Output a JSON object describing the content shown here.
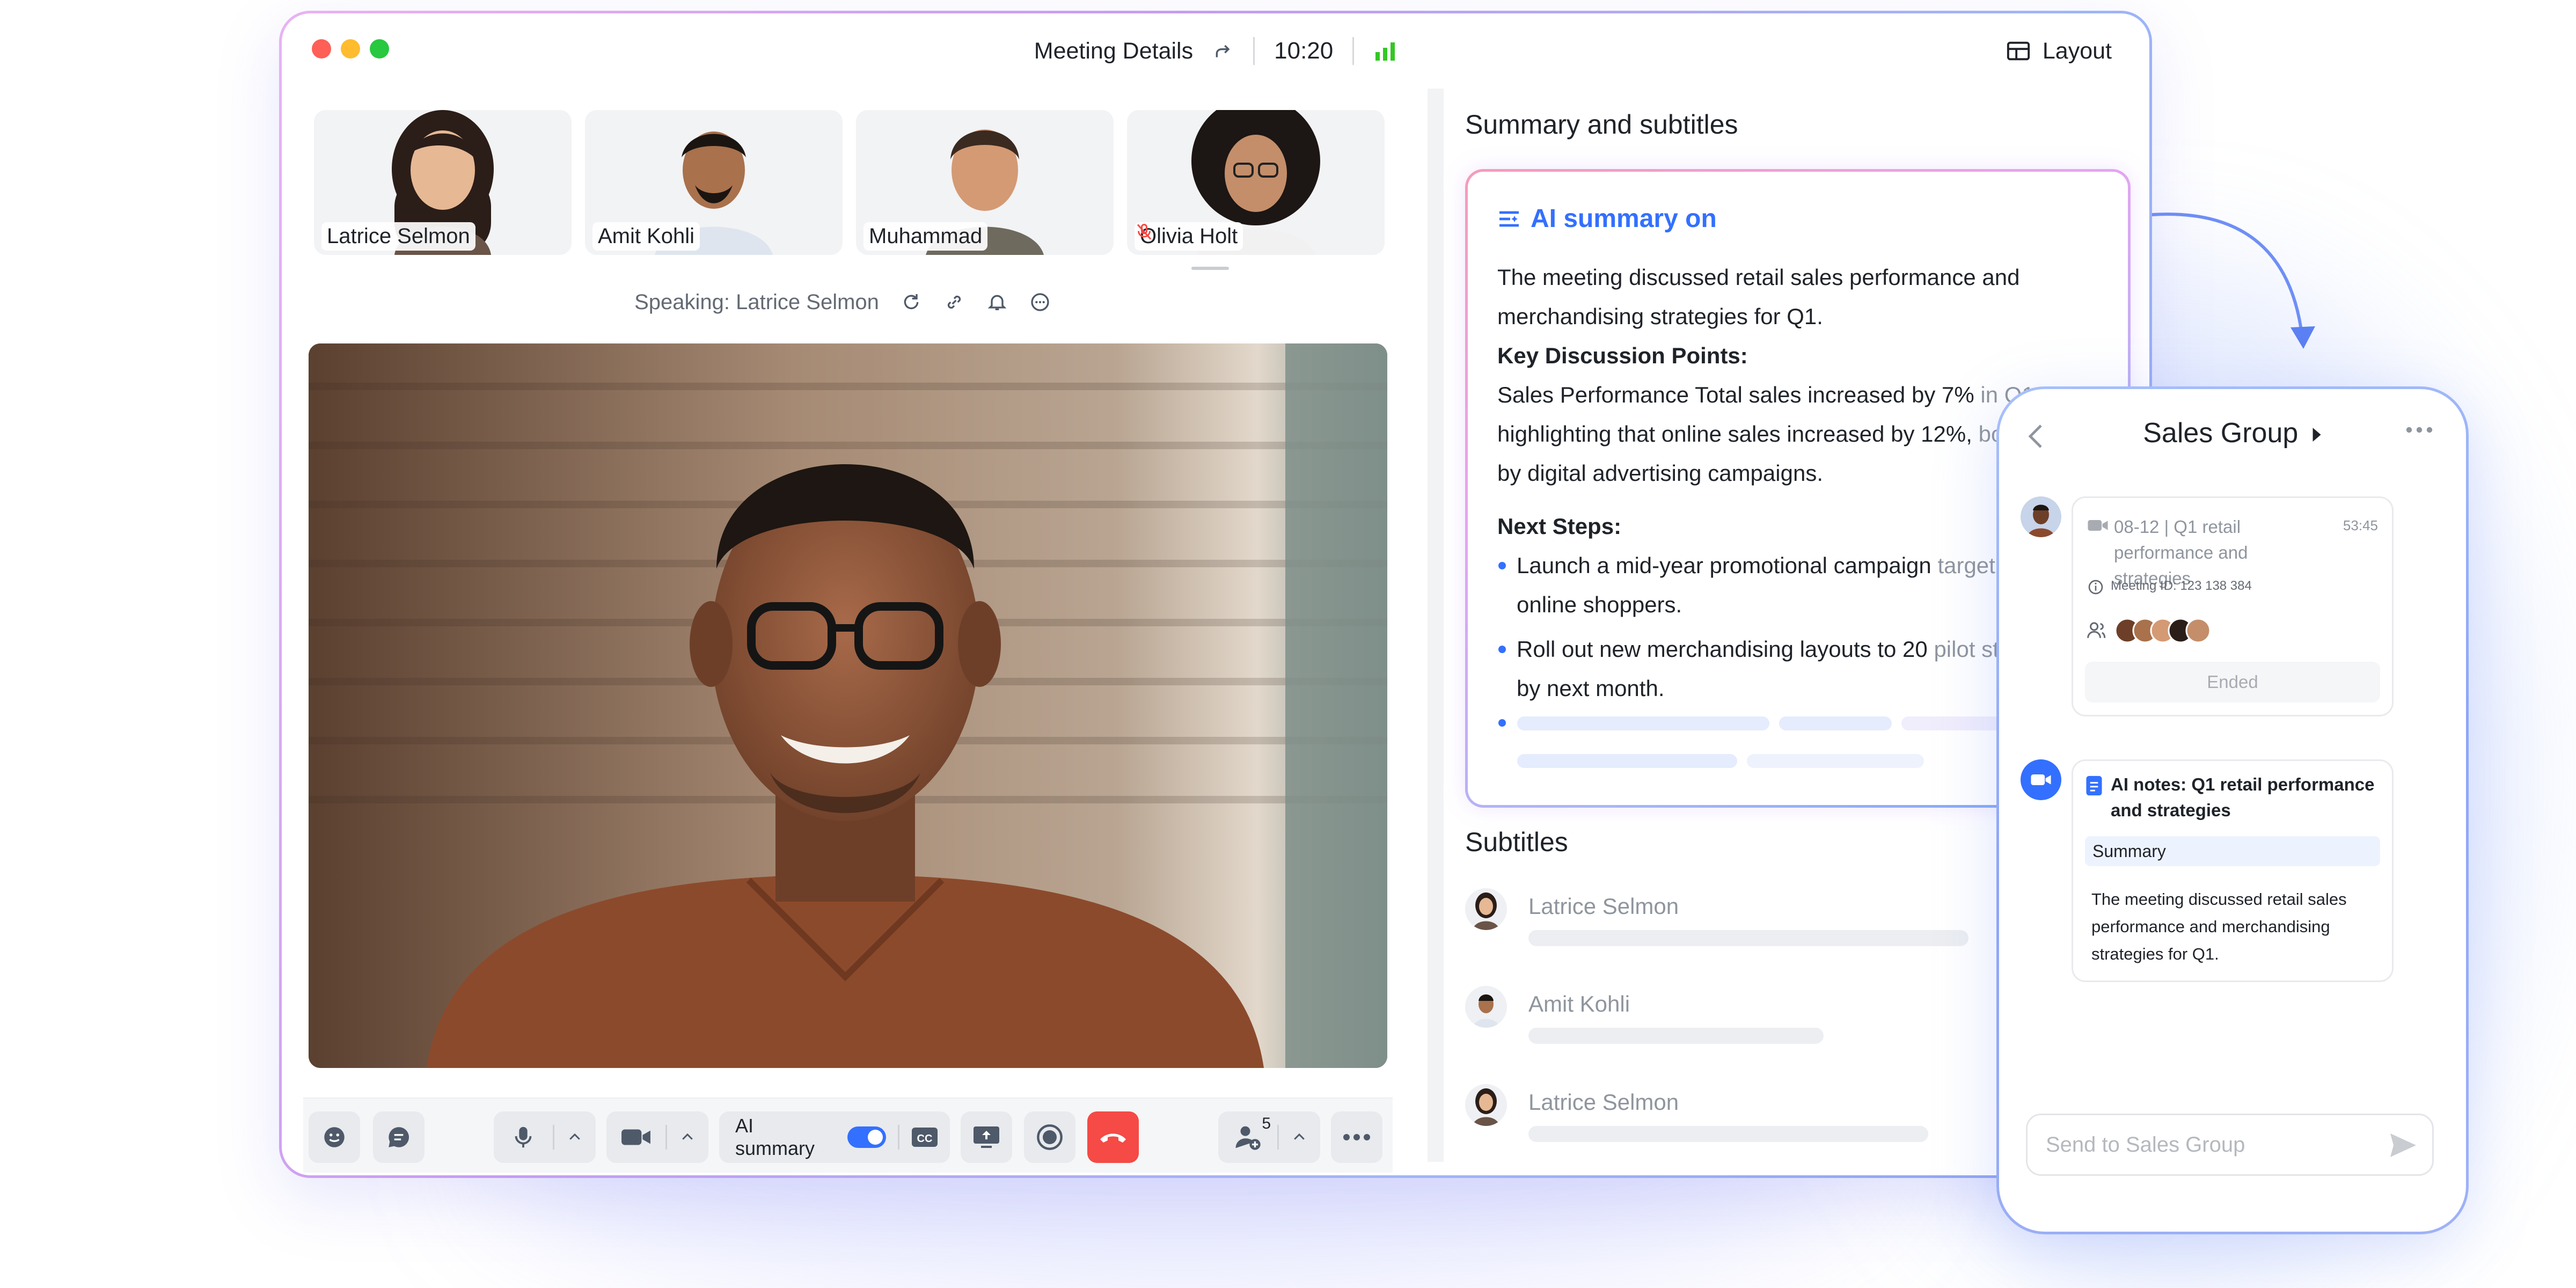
{
  "window": {
    "title": "Meeting Details",
    "time": "10:20",
    "layout_label": "Layout"
  },
  "participants": [
    {
      "name": "Latrice Selmon",
      "muted": false
    },
    {
      "name": "Amit Kohli",
      "muted": false
    },
    {
      "name": "Muhammad",
      "muted": false
    },
    {
      "name": "Olivia Holt",
      "muted": true
    }
  ],
  "speaking": "Speaking: Latrice Selmon",
  "controls": {
    "ai_summary_label": "AI summary",
    "ai_summary_on": true,
    "participant_count": "5"
  },
  "summary_panel": {
    "heading": "Summary and subtitles",
    "ai_status": "AI summary on",
    "intro": "The meeting discussed retail sales performance and merchandising strategies for Q1.",
    "key_heading": "Key Discussion Points:",
    "key_text_a": "Sales Performance Total sales increased by 7% ",
    "key_text_b": "in Q1,",
    "key_text_c": "highlighting that online sales increased by 12%, ",
    "key_text_d": "boos",
    "key_text_e": "by digital advertising campaigns.",
    "next_heading": "Next Steps:",
    "step1_a": "Launch a mid-year promotional campaign ",
    "step1_b": "targetin",
    "step1_c": "online shoppers.",
    "step2_a": "Roll out new merchandising layouts to 20 ",
    "step2_b": "pilot sto",
    "step2_c": "by next month."
  },
  "subtitles": {
    "heading": "Subtitles",
    "rows": [
      {
        "name": "Latrice Selmon"
      },
      {
        "name": "Amit Kohli"
      },
      {
        "name": "Latrice Selmon"
      }
    ]
  },
  "phone": {
    "group_name": "Sales Group",
    "meeting_card": {
      "title": "08-12 | Q1 retail performance and strategies",
      "duration": "53:45",
      "meeting_id": "Meeting ID: 123 138 384",
      "status": "Ended"
    },
    "notes_card": {
      "title": "AI notes: Q1 retail performance and strategies",
      "summary_label": "Summary",
      "text": "The meeting discussed retail sales performance and merchandising strategies for Q1."
    },
    "input_placeholder": "Send to Sales Group"
  },
  "colors": {
    "accent": "#3370ff",
    "end_call": "#f54a45",
    "traffic_red": "#fe5f57",
    "traffic_yellow": "#febc2e",
    "traffic_green": "#28c840",
    "signal_green": "#34c724"
  },
  "icons": [
    "share-icon",
    "signal-icon",
    "layout-icon",
    "refresh-icon",
    "link-icon",
    "bell-icon",
    "more-icon",
    "emoji-icon",
    "chat-icon",
    "mic-icon",
    "camera-icon",
    "cc-icon",
    "share-screen-icon",
    "record-icon",
    "end-call-icon",
    "add-participant-icon",
    "ai-summary-icon",
    "back-icon",
    "video-icon",
    "info-icon",
    "participants-icon",
    "doc-icon",
    "send-icon"
  ]
}
